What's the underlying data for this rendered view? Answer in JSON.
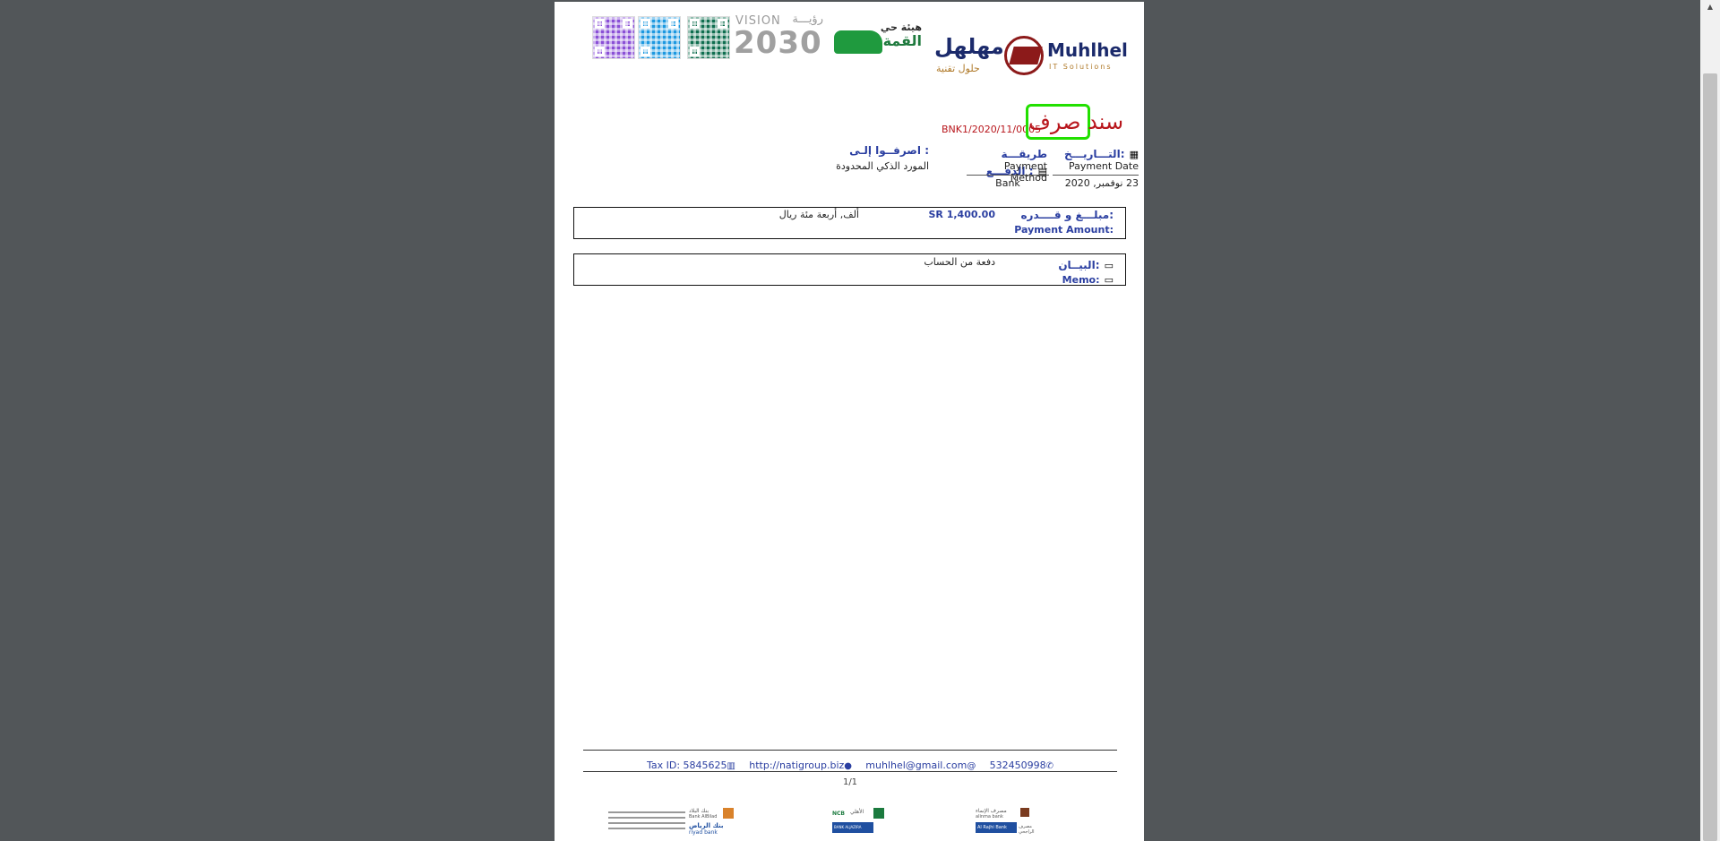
{
  "logos": {
    "company_ar": "مهلهل",
    "company_en": "Muhlhel",
    "company_tag_ar": "حلول تقنية",
    "company_tag_en": "IT Solutions",
    "org_ar": "هيئة حي",
    "org_ar2": "القمة",
    "vision_ar": "رؤيـــة",
    "vision_en": "VISION",
    "vision_year": "2030"
  },
  "voucher": {
    "title": "سند صرف",
    "number": "BNK1/2020/11/0005",
    "date_label_ar": "التـــاريـــخ:",
    "date_label_en": "Payment Date",
    "date_value": "23 نوفمبر, 2020",
    "method_label_ar": "طريقـــة الدفـــع :",
    "method_label_en": "Payment Method",
    "method_value": "Bank",
    "payee_label_ar": "اصرفــوا إلـى :",
    "payee_value": "المورد الذكي المحدودة",
    "amount_label_ar": "مبلـــغ و قــــدره:",
    "amount_label_en": "Payment Amount:",
    "amount_value": "SR 1,400.00",
    "amount_words": "ألف, أربعة مئة ريال",
    "memo_label_ar": "البيــان:",
    "memo_label_en": "Memo:",
    "memo_value": "دفعة من الحساب"
  },
  "footer": {
    "tax": "Tax ID: 5845625",
    "website": "http://natigroup.biz",
    "email": "muhlhel@gmail.com",
    "phone": "532450998",
    "page": "1/1"
  },
  "banks": [
    {
      "name": "مصرف الإنماء",
      "name_en": "alinma bank"
    },
    {
      "name": "الأهلي",
      "name_en": "NCB"
    },
    {
      "name": "بنك البلاد",
      "name_en": "Bank AlBilad"
    },
    {
      "name": "بنك الرياض",
      "name_en": "riyad bank"
    },
    {
      "name": "مصرف الراجحي",
      "name_en": "Al Rajhi Bank"
    },
    {
      "name": "بنك الجزيرة",
      "name_en": "BANK ALJAZIRA"
    }
  ],
  "colors": {
    "title_red": "#b8161c",
    "label_blue": "#2b3fa1",
    "highlight_green": "#22e000",
    "viewer_bg": "#525659"
  }
}
